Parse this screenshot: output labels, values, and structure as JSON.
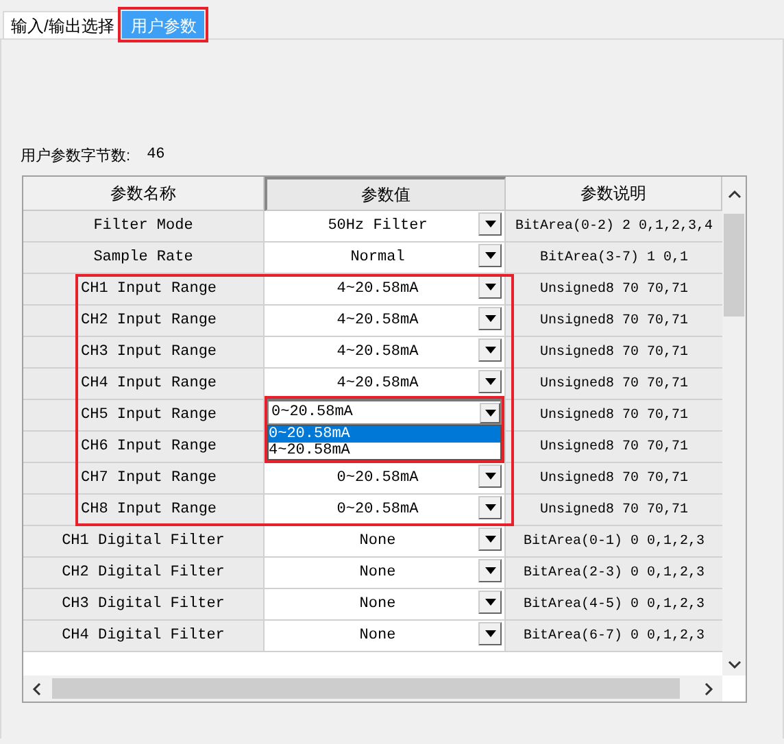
{
  "tabs": [
    {
      "label": "输入/输出选择",
      "selected": false,
      "highlighted": false
    },
    {
      "label": "用户参数",
      "selected": true,
      "highlighted": true
    }
  ],
  "byte_count": {
    "label": "用户参数字节数:",
    "value": "46"
  },
  "table": {
    "columns": [
      "参数名称",
      "参数值",
      "参数说明"
    ],
    "rows": [
      {
        "name": "Filter Mode",
        "value": "50Hz Filter",
        "description": "BitArea(0-2) 2 0,1,2,3,4",
        "highlighted": false
      },
      {
        "name": "Sample Rate",
        "value": "Normal",
        "description": "BitArea(3-7) 1 0,1",
        "highlighted": false
      },
      {
        "name": "CH1 Input Range",
        "value": "4~20.58mA",
        "description": "Unsigned8 70 70,71",
        "highlighted": true
      },
      {
        "name": "CH2 Input Range",
        "value": "4~20.58mA",
        "description": "Unsigned8 70 70,71",
        "highlighted": true
      },
      {
        "name": "CH3 Input Range",
        "value": "4~20.58mA",
        "description": "Unsigned8 70 70,71",
        "highlighted": true
      },
      {
        "name": "CH4 Input Range",
        "value": "4~20.58mA",
        "description": "Unsigned8 70 70,71",
        "highlighted": true
      },
      {
        "name": "CH5 Input Range",
        "value": "0~20.58mA",
        "description": "Unsigned8 70 70,71",
        "highlighted": true,
        "dropdown": {
          "highlighted": true,
          "options": [
            {
              "label": "0~20.58mA",
              "selected": true
            },
            {
              "label": "4~20.58mA",
              "selected": false
            }
          ]
        }
      },
      {
        "name": "CH6 Input Range",
        "value": "",
        "description": "Unsigned8 70 70,71",
        "highlighted": true
      },
      {
        "name": "CH7 Input Range",
        "value": "0~20.58mA",
        "description": "Unsigned8 70 70,71",
        "highlighted": true
      },
      {
        "name": "CH8 Input Range",
        "value": "0~20.58mA",
        "description": "Unsigned8 70 70,71",
        "highlighted": true
      },
      {
        "name": "CH1 Digital Filter",
        "value": "None",
        "description": "BitArea(0-1) 0 0,1,2,3",
        "highlighted": false
      },
      {
        "name": "CH2 Digital Filter",
        "value": "None",
        "description": "BitArea(2-3) 0 0,1,2,3",
        "highlighted": false
      },
      {
        "name": "CH3 Digital Filter",
        "value": "None",
        "description": "BitArea(4-5) 0 0,1,2,3",
        "highlighted": false
      },
      {
        "name": "CH4 Digital Filter",
        "value": "None",
        "description": "BitArea(6-7) 0 0,1,2,3",
        "highlighted": false
      }
    ]
  }
}
